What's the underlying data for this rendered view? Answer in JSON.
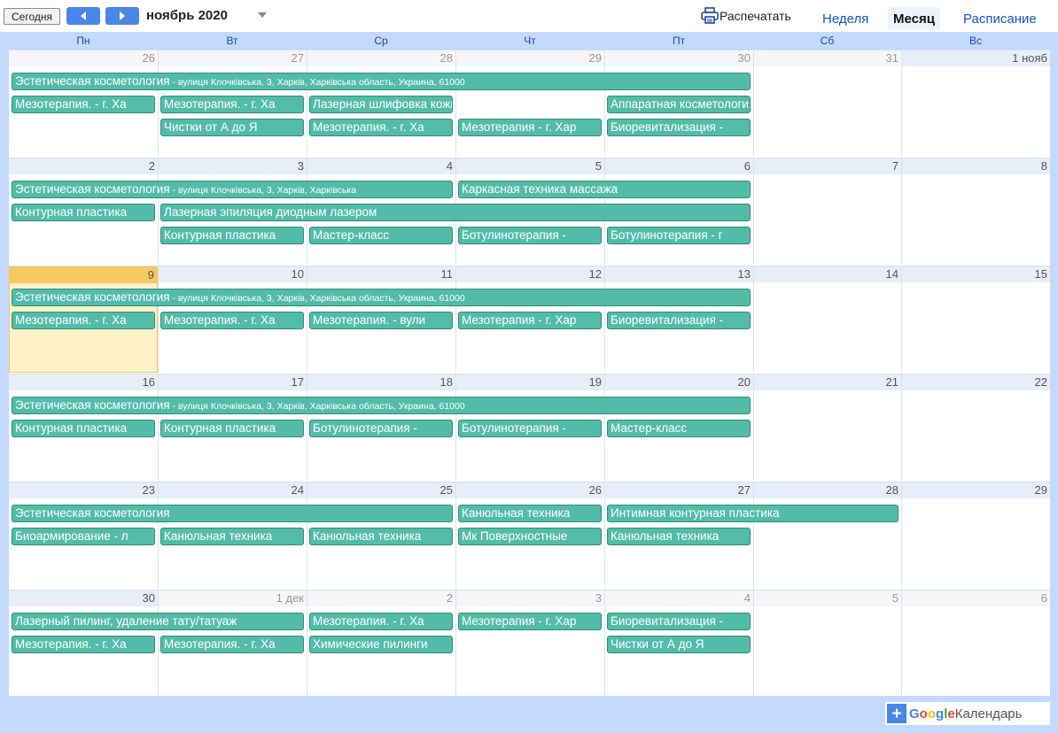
{
  "toolbar": {
    "today_label": "Сегодня",
    "month_title": "ноябрь 2020",
    "print_label": "Распечатать",
    "tabs": [
      {
        "label": "Неделя",
        "active": false
      },
      {
        "label": "Месяц",
        "active": true
      },
      {
        "label": "Расписание",
        "active": false
      }
    ]
  },
  "weekdays": [
    "Пн",
    "Вт",
    "Ср",
    "Чт",
    "Пт",
    "Сб",
    "Вс"
  ],
  "colors": {
    "event": "#53bca9",
    "event_border": "#2b8f7e",
    "today": "#fff1c6",
    "accent": "#4a86e8"
  },
  "weeks": [
    {
      "days": [
        {
          "label": "26",
          "other": true
        },
        {
          "label": "27",
          "other": true
        },
        {
          "label": "28",
          "other": true
        },
        {
          "label": "29",
          "other": true
        },
        {
          "label": "30",
          "other": true
        },
        {
          "label": "31",
          "other": true
        },
        {
          "label": "1 нояб",
          "other": false
        }
      ],
      "events": [
        {
          "title": "Эстетическая косметология",
          "detail": " - вулиця Клочківська, 3, Харків, Харківська область, Украина, 61000",
          "start": 0,
          "span": 5,
          "row": 0
        },
        {
          "title": "Мезотерапия. - г. Ха",
          "detail": "",
          "start": 0,
          "span": 1,
          "row": 1
        },
        {
          "title": "Мезотерапия. - г. Ха",
          "detail": "",
          "start": 1,
          "span": 1,
          "row": 1
        },
        {
          "title": "Лазерная шлифовка кожи, постакне, руб",
          "detail": "",
          "start": 2,
          "span": 1,
          "row": 1
        },
        {
          "title": "Аппаратная косметология",
          "detail": "",
          "start": 4,
          "span": 1,
          "row": 1
        },
        {
          "title": "Чистки от А до Я",
          "detail": "",
          "start": 1,
          "span": 1,
          "row": 2
        },
        {
          "title": "Мезотерапия. - г. Ха",
          "detail": "",
          "start": 2,
          "span": 1,
          "row": 2
        },
        {
          "title": "Мезотерапия - г. Хар",
          "detail": "",
          "start": 3,
          "span": 1,
          "row": 2
        },
        {
          "title": "Биоревитализация -",
          "detail": "",
          "start": 4,
          "span": 1,
          "row": 2
        }
      ]
    },
    {
      "days": [
        {
          "label": "2",
          "other": false
        },
        {
          "label": "3",
          "other": false
        },
        {
          "label": "4",
          "other": false
        },
        {
          "label": "5",
          "other": false
        },
        {
          "label": "6",
          "other": false
        },
        {
          "label": "7",
          "other": false
        },
        {
          "label": "8",
          "other": false
        }
      ],
      "events": [
        {
          "title": "Эстетическая косметология",
          "detail": " - вулиця Клочківська, 3, Харків, Харківська",
          "start": 0,
          "span": 3,
          "row": 0
        },
        {
          "title": "Каркасная техника массажа",
          "detail": "",
          "start": 3,
          "span": 2,
          "row": 0
        },
        {
          "title": "Контурная пластика",
          "detail": "",
          "start": 0,
          "span": 1,
          "row": 1
        },
        {
          "title": "Лазерная эпиляция диодным лазером",
          "detail": "",
          "start": 1,
          "span": 4,
          "row": 1
        },
        {
          "title": "Контурная пластика",
          "detail": "",
          "start": 1,
          "span": 1,
          "row": 2
        },
        {
          "title": "Мастер-класс",
          "detail": "",
          "start": 2,
          "span": 1,
          "row": 2
        },
        {
          "title": "Ботулинотерапия -",
          "detail": "",
          "start": 3,
          "span": 1,
          "row": 2
        },
        {
          "title": "Ботулинотерапия - г",
          "detail": "",
          "start": 4,
          "span": 1,
          "row": 2
        }
      ]
    },
    {
      "days": [
        {
          "label": "9",
          "other": false,
          "today": true
        },
        {
          "label": "10",
          "other": false
        },
        {
          "label": "11",
          "other": false
        },
        {
          "label": "12",
          "other": false
        },
        {
          "label": "13",
          "other": false
        },
        {
          "label": "14",
          "other": false
        },
        {
          "label": "15",
          "other": false
        }
      ],
      "events": [
        {
          "title": "Эстетическая косметология",
          "detail": " - вулиця Клочківська, 3, Харків, Харківська область, Украина, 61000",
          "start": 0,
          "span": 5,
          "row": 0
        },
        {
          "title": "Мезотерапия. - г. Ха",
          "detail": "",
          "start": 0,
          "span": 1,
          "row": 1
        },
        {
          "title": "Мезотерапия. - г. Ха",
          "detail": "",
          "start": 1,
          "span": 1,
          "row": 1
        },
        {
          "title": "Мезотерапия. - вули",
          "detail": "",
          "start": 2,
          "span": 1,
          "row": 1
        },
        {
          "title": "Мезотерапия - г. Хар",
          "detail": "",
          "start": 3,
          "span": 1,
          "row": 1
        },
        {
          "title": "Биоревитализация -",
          "detail": "",
          "start": 4,
          "span": 1,
          "row": 1
        }
      ]
    },
    {
      "days": [
        {
          "label": "16",
          "other": false
        },
        {
          "label": "17",
          "other": false
        },
        {
          "label": "18",
          "other": false
        },
        {
          "label": "19",
          "other": false
        },
        {
          "label": "20",
          "other": false
        },
        {
          "label": "21",
          "other": false
        },
        {
          "label": "22",
          "other": false
        }
      ],
      "events": [
        {
          "title": "Эстетическая косметология",
          "detail": " - вулиця Клочківська, 3, Харків, Харківська область, Украина, 61000",
          "start": 0,
          "span": 5,
          "row": 0
        },
        {
          "title": "Контурная пластика",
          "detail": "",
          "start": 0,
          "span": 1,
          "row": 1
        },
        {
          "title": "Контурная пластика",
          "detail": "",
          "start": 1,
          "span": 1,
          "row": 1
        },
        {
          "title": "Ботулинотерапия -",
          "detail": "",
          "start": 2,
          "span": 1,
          "row": 1
        },
        {
          "title": "Ботулинотерапия -",
          "detail": "",
          "start": 3,
          "span": 1,
          "row": 1
        },
        {
          "title": "Мастер-класс",
          "detail": "",
          "start": 4,
          "span": 1,
          "row": 1
        }
      ]
    },
    {
      "days": [
        {
          "label": "23",
          "other": false
        },
        {
          "label": "24",
          "other": false
        },
        {
          "label": "25",
          "other": false
        },
        {
          "label": "26",
          "other": false
        },
        {
          "label": "27",
          "other": false
        },
        {
          "label": "28",
          "other": false
        },
        {
          "label": "29",
          "other": false
        }
      ],
      "events": [
        {
          "title": "Эстетическая косметология",
          "detail": "",
          "start": 0,
          "span": 3,
          "row": 0
        },
        {
          "title": "Канюльная техника",
          "detail": "",
          "start": 3,
          "span": 1,
          "row": 0
        },
        {
          "title": "Интимная контурная пластика",
          "detail": "",
          "start": 4,
          "span": 2,
          "row": 0
        },
        {
          "title": "Биоармирование - л",
          "detail": "",
          "start": 0,
          "span": 1,
          "row": 1
        },
        {
          "title": "Канюльная техника",
          "detail": "",
          "start": 1,
          "span": 1,
          "row": 1
        },
        {
          "title": "Канюльная техника",
          "detail": "",
          "start": 2,
          "span": 1,
          "row": 1
        },
        {
          "title": "Мк Поверхностные",
          "detail": "",
          "start": 3,
          "span": 1,
          "row": 1
        },
        {
          "title": "Канюльная техника",
          "detail": "",
          "start": 4,
          "span": 1,
          "row": 1
        }
      ]
    },
    {
      "days": [
        {
          "label": "30",
          "other": false
        },
        {
          "label": "1 дек",
          "other": true
        },
        {
          "label": "2",
          "other": true
        },
        {
          "label": "3",
          "other": true
        },
        {
          "label": "4",
          "other": true
        },
        {
          "label": "5",
          "other": true
        },
        {
          "label": "6",
          "other": true
        }
      ],
      "events": [
        {
          "title": "Лазерный пилинг, удаление тату/татуаж",
          "detail": "",
          "start": 0,
          "span": 2,
          "row": 0
        },
        {
          "title": "Мезотерапия. - г. Ха",
          "detail": "",
          "start": 2,
          "span": 1,
          "row": 0
        },
        {
          "title": "Мезотерапия - г. Хар",
          "detail": "",
          "start": 3,
          "span": 1,
          "row": 0
        },
        {
          "title": "Биоревитализация -",
          "detail": "",
          "start": 4,
          "span": 1,
          "row": 0
        },
        {
          "title": "Мезотерапия. - г. Ха",
          "detail": "",
          "start": 0,
          "span": 1,
          "row": 1
        },
        {
          "title": "Мезотерапия. - г. Ха",
          "detail": "",
          "start": 1,
          "span": 1,
          "row": 1
        },
        {
          "title": "Химические пилинги",
          "detail": "",
          "start": 2,
          "span": 1,
          "row": 1
        },
        {
          "title": "Чистки от А до Я",
          "detail": "",
          "start": 4,
          "span": 1,
          "row": 1
        }
      ]
    }
  ],
  "footer": {
    "plus": "+",
    "google": "Google",
    "calendar": "Календарь"
  }
}
